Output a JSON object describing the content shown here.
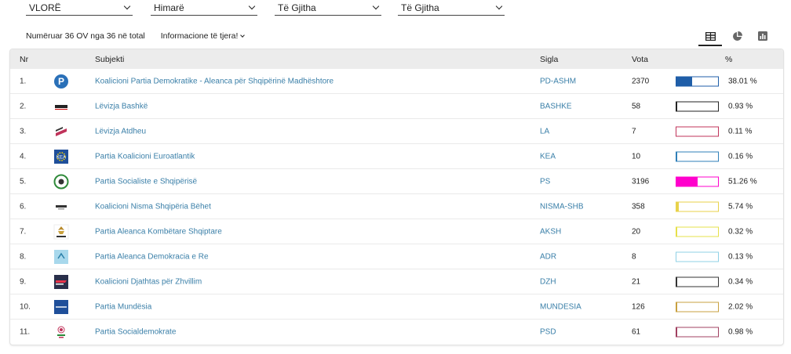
{
  "filters": [
    {
      "value": "VLORË"
    },
    {
      "value": "Himarë"
    },
    {
      "value": "Të Gjitha"
    },
    {
      "value": "Të Gjitha"
    }
  ],
  "info": {
    "count_text": "Numëruar 36 OV nga 36 në total",
    "more_label": "Informacione të tjera!"
  },
  "views": [
    "table-icon",
    "pie-chart-icon",
    "bar-chart-icon"
  ],
  "table": {
    "headers": {
      "nr": "Nr",
      "subjekti": "Subjekti",
      "sigla": "Sigla",
      "vota": "Vota",
      "pct": "%"
    },
    "rows": [
      {
        "nr": "1.",
        "subjekti": "Koalicioni Partia Demokratike - Aleanca për Shqipërinë Madhështore",
        "sigla": "PD-ASHM",
        "vota": "2370",
        "pct": "38.01 %",
        "share": 38.01,
        "color": "#1f5ea8",
        "logo": "pd-logo"
      },
      {
        "nr": "2.",
        "subjekti": "Lëvizja Bashkë",
        "sigla": "BASHKE",
        "vota": "58",
        "pct": "0.93 %",
        "share": 0.93,
        "color": "#222222",
        "logo": "bashke-logo"
      },
      {
        "nr": "3.",
        "subjekti": "Lëvizja Atdheu",
        "sigla": "LA",
        "vota": "7",
        "pct": "0.11 %",
        "share": 0.11,
        "color": "#c0335a",
        "logo": "la-logo"
      },
      {
        "nr": "4.",
        "subjekti": "Partia Koalicioni Euroatlantik",
        "sigla": "KEA",
        "vota": "10",
        "pct": "0.16 %",
        "share": 0.16,
        "color": "#2f7fb8",
        "logo": "kea-logo"
      },
      {
        "nr": "5.",
        "subjekti": "Partia Socialiste e Shqipërisë",
        "sigla": "PS",
        "vota": "3196",
        "pct": "51.26 %",
        "share": 51.26,
        "color": "#ff00cc",
        "logo": "ps-logo"
      },
      {
        "nr": "6.",
        "subjekti": "Koalicioni Nisma Shqipëria Bëhet",
        "sigla": "NISMA-SHB",
        "vota": "358",
        "pct": "5.74 %",
        "share": 5.74,
        "color": "#e8d24a",
        "logo": "nisma-logo"
      },
      {
        "nr": "7.",
        "subjekti": "Partia Aleanca Kombëtare Shqiptare",
        "sigla": "AKSH",
        "vota": "20",
        "pct": "0.32 %",
        "share": 0.32,
        "color": "#e6e04a",
        "logo": "aksh-logo"
      },
      {
        "nr": "8.",
        "subjekti": "Partia Aleanca Demokracia e Re",
        "sigla": "ADR",
        "vota": "8",
        "pct": "0.13 %",
        "share": 0.13,
        "color": "#8fd0e6",
        "logo": "adr-logo"
      },
      {
        "nr": "9.",
        "subjekti": "Koalicioni Djathtas për Zhvillim",
        "sigla": "DZH",
        "vota": "21",
        "pct": "0.34 %",
        "share": 0.34,
        "color": "#333333",
        "logo": "dzh-logo"
      },
      {
        "nr": "10.",
        "subjekti": "Partia Mundësia",
        "sigla": "MUNDESIA",
        "vota": "126",
        "pct": "2.02 %",
        "share": 2.02,
        "color": "#c8a040",
        "logo": "mundesia-logo"
      },
      {
        "nr": "11.",
        "subjekti": "Partia Socialdemokrate",
        "sigla": "PSD",
        "vota": "61",
        "pct": "0.98 %",
        "share": 0.98,
        "color": "#a04060",
        "logo": "psd-logo"
      }
    ]
  }
}
